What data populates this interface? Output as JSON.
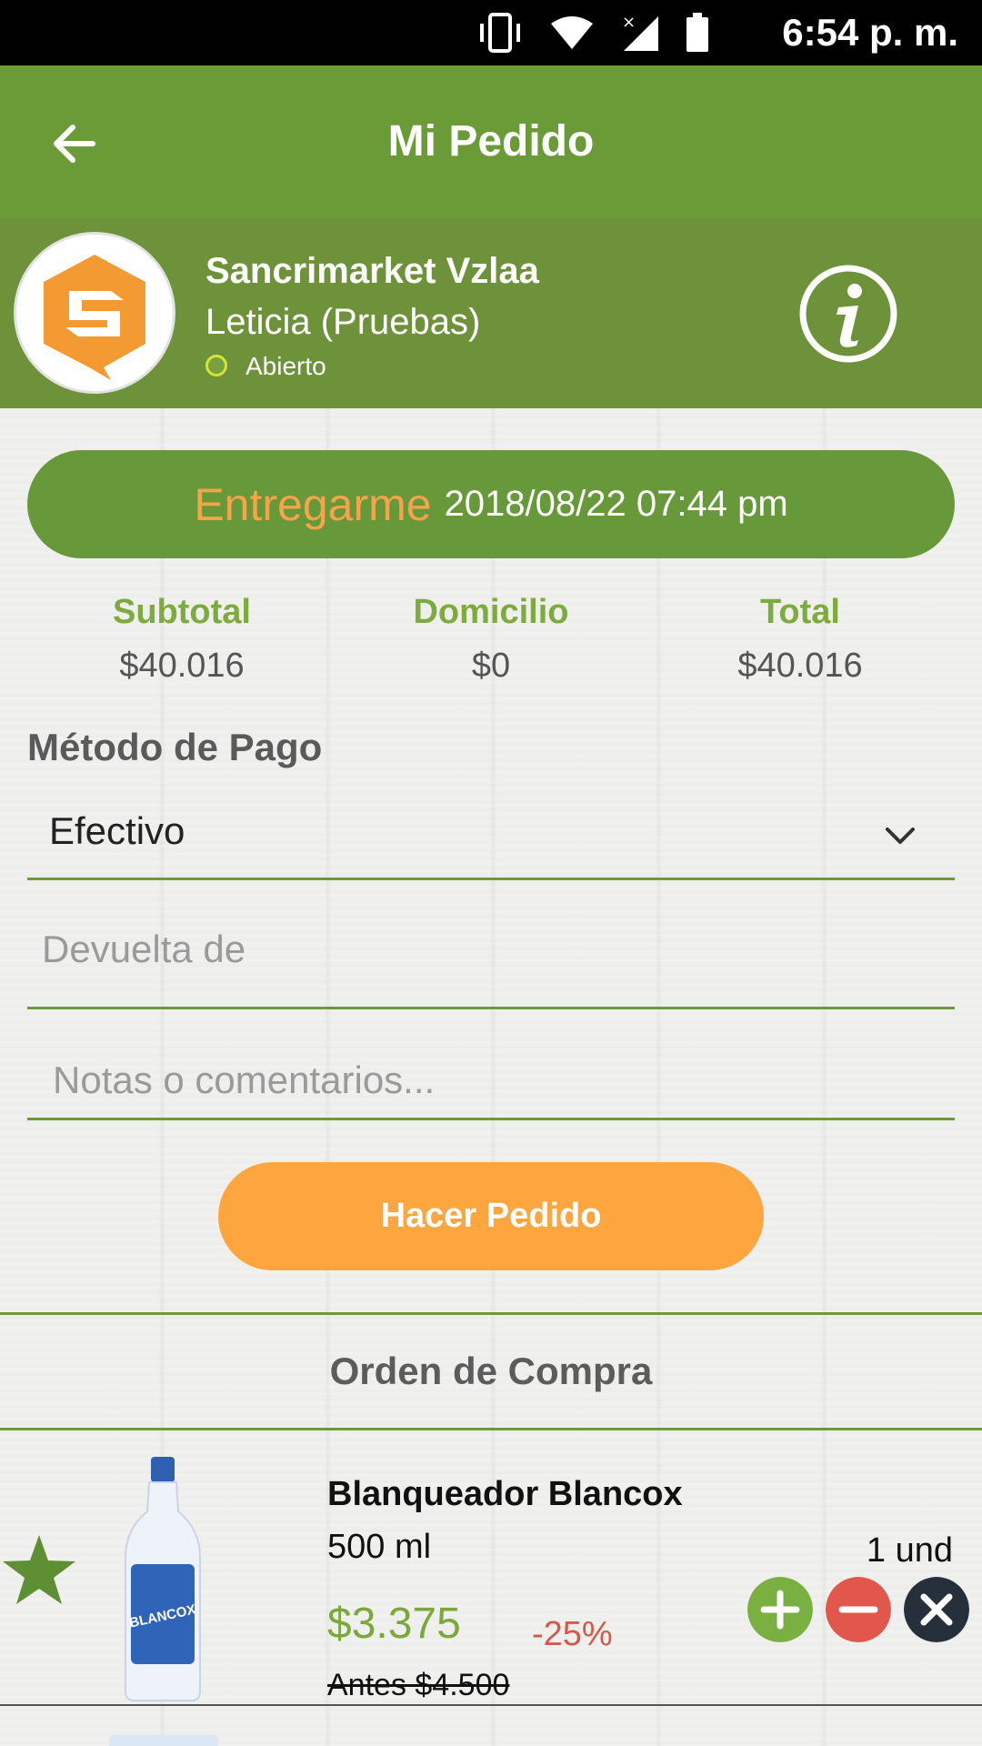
{
  "status_bar": {
    "time": "6:54 p. m."
  },
  "app_bar": {
    "title": "Mi Pedido"
  },
  "store": {
    "name": "Sancrimarket Vzlaa",
    "branch": "Leticia (Pruebas)",
    "status": "Abierto"
  },
  "delivery": {
    "label": "Entregarme",
    "datetime": "2018/08/22 07:44 pm"
  },
  "totals": {
    "subtotal_label": "Subtotal",
    "subtotal": "$40.016",
    "delivery_label": "Domicilio",
    "delivery": "$0",
    "total_label": "Total",
    "total": "$40.016"
  },
  "payment": {
    "heading": "Método de Pago",
    "selected": "Efectivo",
    "change_placeholder": "Devuelta de",
    "notes_placeholder": "Notas o comentarios..."
  },
  "order_button": "Hacer Pedido",
  "order_section": {
    "heading": "Orden de Compra"
  },
  "products": [
    {
      "name": "Blanqueador Blancox",
      "size": "500 ml",
      "price": "$3.375",
      "discount": "-25%",
      "old_price": "Antes $4.500",
      "quantity": "1 und",
      "image_label": "BLANCOX"
    }
  ],
  "colors": {
    "primary_green": "#6a9b37",
    "header_green": "#6e923a",
    "accent_orange": "#fda63f",
    "price_green": "#7aa83b",
    "discount_red": "#d35a4a",
    "remove_dark": "#25303a"
  },
  "icons": {
    "back": "arrow-left",
    "info": "info-circle",
    "dropdown": "chevron-down",
    "favorite": "star",
    "add": "plus-circle",
    "decrease": "minus-circle",
    "remove": "close-circle"
  }
}
